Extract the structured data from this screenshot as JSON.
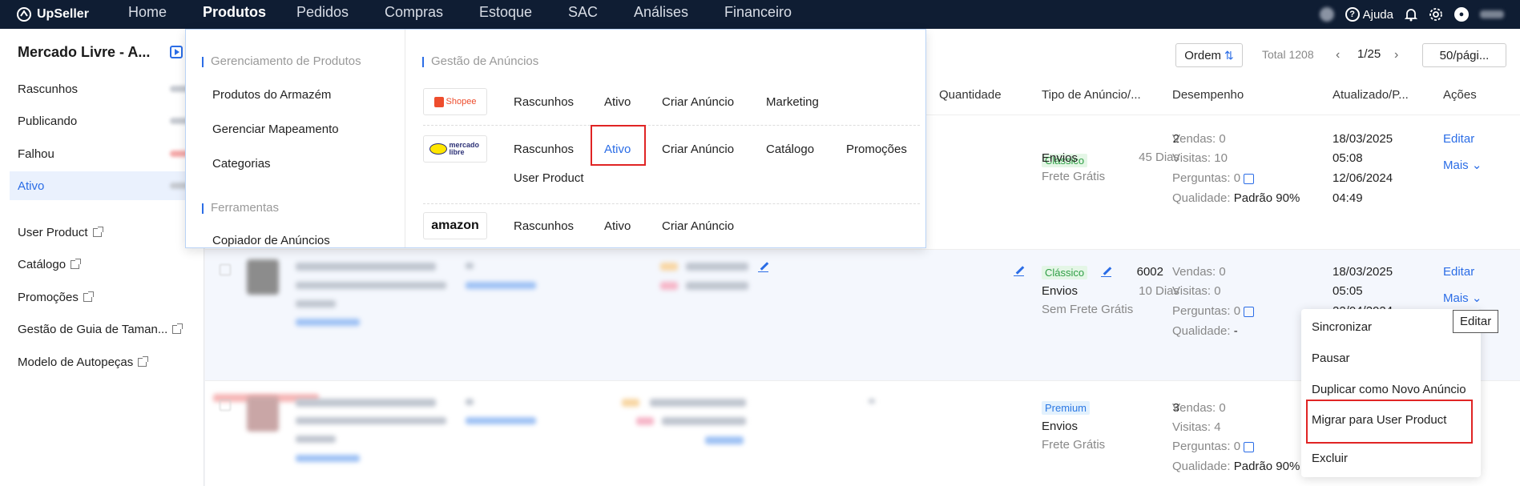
{
  "brand": {
    "name": "UpSeller"
  },
  "nav": {
    "items": [
      {
        "label": "Home"
      },
      {
        "label": "Produtos"
      },
      {
        "label": "Pedidos"
      },
      {
        "label": "Compras"
      },
      {
        "label": "Estoque"
      },
      {
        "label": "SAC"
      },
      {
        "label": "Análises"
      },
      {
        "label": "Financeiro"
      }
    ],
    "help_label": "Ajuda"
  },
  "sidebar": {
    "title": "Mercado Livre - A...",
    "items": [
      {
        "label": "Rascunhos"
      },
      {
        "label": "Publicando"
      },
      {
        "label": "Falhou"
      },
      {
        "label": "Ativo"
      }
    ],
    "links": [
      {
        "label": "User Product"
      },
      {
        "label": "Catálogo"
      },
      {
        "label": "Promoções"
      },
      {
        "label": "Gestão de Guia de Taman..."
      },
      {
        "label": "Modelo de Autopeças"
      }
    ]
  },
  "toolbar": {
    "order_label": "Ordem",
    "total_label": "Total 1208",
    "page_label": "1/25",
    "per_page_label": "50/pági..."
  },
  "table": {
    "headers": [
      "Quantidade",
      "Tipo de Anúncio/...",
      "Desempenho",
      "Atualizado/P...",
      "Ações"
    ],
    "rows": [
      {
        "qty": "2",
        "days": "45 Dias",
        "tag": "Clássico",
        "shipping": "Envios",
        "shipping_sub": "Frete Grátis",
        "vendas": "Vendas: 0",
        "visitas": "Visitas: 10",
        "perguntas": "Perguntas: 0",
        "qualidade_label": "Qualidade: ",
        "qualidade_value": "Padrão 90%",
        "updated_date": "18/03/2025",
        "updated_time": "05:08",
        "published_date": "12/06/2024",
        "published_time": "04:49",
        "edit": "Editar",
        "more": "Mais"
      },
      {
        "qty": "6002",
        "days": "10 Dias",
        "tag": "Clássico",
        "shipping": "Envios",
        "shipping_sub": "Sem Frete Grátis",
        "vendas": "Vendas: 0",
        "visitas": "Visitas: 0",
        "perguntas": "Perguntas: 0",
        "qualidade_label": "Qualidade: ",
        "qualidade_value": "-",
        "updated_date": "18/03/2025",
        "updated_time": "05:05",
        "published_date": "22/04/2024",
        "edit": "Editar",
        "more": "Mais"
      },
      {
        "qty": "3",
        "tag": "Premium",
        "shipping": "Envios",
        "shipping_sub": "Frete Grátis",
        "vendas": "Vendas: 0",
        "visitas": "Visitas: 4",
        "perguntas": "Perguntas: 0",
        "qualidade_label": "Qualidade: ",
        "qualidade_value": "Padrão 90%"
      }
    ]
  },
  "mega_menu": {
    "left_sections": [
      {
        "title": "Gerenciamento de Produtos",
        "items": [
          "Produtos do Armazém",
          "Gerenciar Mapeamento",
          "Categorias"
        ]
      },
      {
        "title": "Ferramentas",
        "items": [
          "Copiador de Anúncios"
        ]
      }
    ],
    "right_title": "Gestão de Anúncios",
    "marketplaces": [
      {
        "logo_text": "Shopee",
        "links": [
          "Rascunhos",
          "Ativo",
          "Criar Anúncio",
          "Marketing"
        ]
      },
      {
        "logo_text": "mercado libre",
        "links": [
          "Rascunhos",
          "Ativo",
          "Criar Anúncio",
          "Catálogo",
          "Promoções",
          "User Product"
        ]
      },
      {
        "logo_text": "amazon",
        "links": [
          "Rascunhos",
          "Ativo",
          "Criar Anúncio"
        ]
      }
    ]
  },
  "more_menu": {
    "items": [
      "Sincronizar",
      "Pausar",
      "Duplicar como Novo Anúncio",
      "Migrar para User Product",
      "Excluir"
    ]
  },
  "tooltip": {
    "label": "Editar"
  },
  "colors": {
    "nav_bg": "#0f1d33",
    "accent": "#2b6de6",
    "highlight_box": "#e02424",
    "shopee": "#ee4d2d"
  }
}
